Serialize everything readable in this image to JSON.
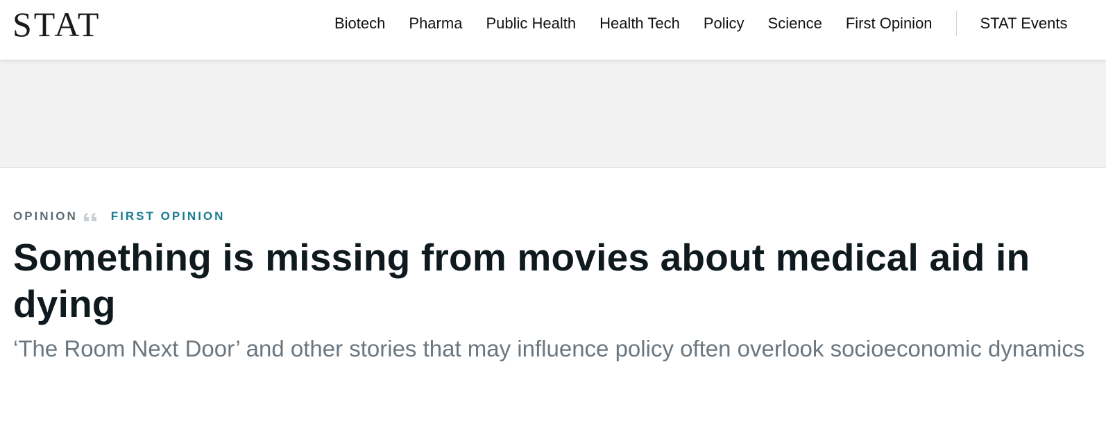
{
  "header": {
    "logo": "STAT",
    "nav": [
      {
        "label": "Biotech"
      },
      {
        "label": "Pharma"
      },
      {
        "label": "Public Health"
      },
      {
        "label": "Health Tech"
      },
      {
        "label": "Policy"
      },
      {
        "label": "Science"
      },
      {
        "label": "First Opinion"
      }
    ],
    "events_label": "STAT Events"
  },
  "article": {
    "category": "OPINION",
    "section": "FIRST OPINION",
    "headline": "Something is missing from movies about medical aid in dying",
    "dek": "‘The Room Next Door’ and other stories that may influence policy often overlook socioeconomic dynamics"
  },
  "colors": {
    "section_accent": "#197b93",
    "category_gray": "#5f6a72",
    "dek_gray": "#6b7780",
    "ad_band": "#f2f2f2"
  }
}
